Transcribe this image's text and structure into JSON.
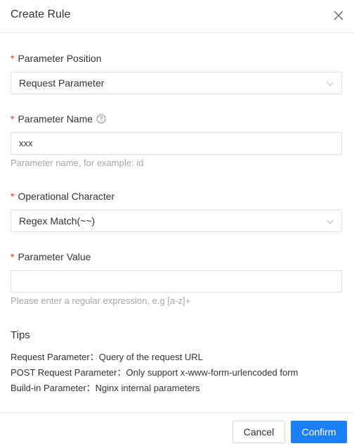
{
  "dialog": {
    "title": "Create Rule"
  },
  "form": {
    "position": {
      "required_mark": "*",
      "label": "Parameter Position",
      "value": "Request Parameter"
    },
    "name": {
      "required_mark": "*",
      "label": "Parameter Name",
      "value": "xxx",
      "hint": "Parameter name, for example: id"
    },
    "operator": {
      "required_mark": "*",
      "label": "Operational Character",
      "value": "Regex Match(~~)"
    },
    "param_value": {
      "required_mark": "*",
      "label": "Parameter Value",
      "value": "",
      "hint": "Please enter a regular expression, e.g [a-z]+"
    }
  },
  "tips": {
    "title": "Tips",
    "lines": [
      "Request Parameter：Query of the request URL",
      "POST Request Parameter：Only support x-www-form-urlencoded form",
      "Build-in Parameter：Nginx internal parameters"
    ]
  },
  "footer": {
    "cancel_label": "Cancel",
    "confirm_label": "Confirm"
  },
  "colors": {
    "primary": "#1b7ff5",
    "required": "#e0301e",
    "hint": "#a6a6a6"
  }
}
